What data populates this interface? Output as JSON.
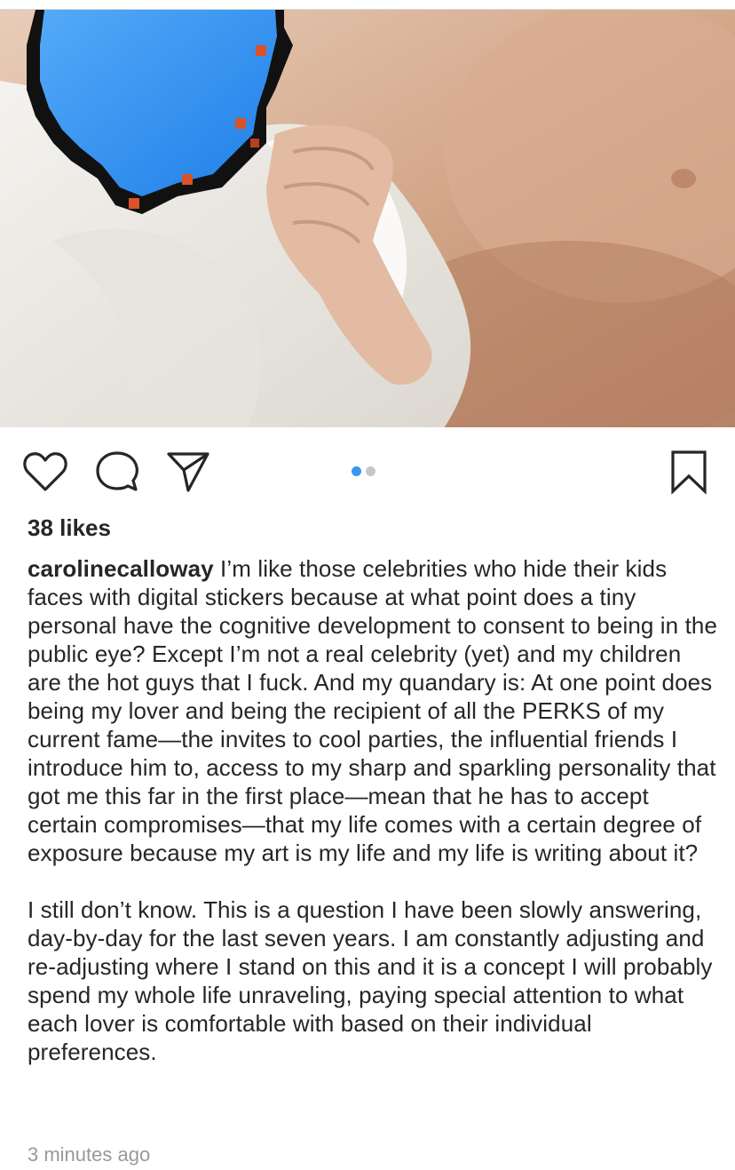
{
  "post": {
    "likes_text": "38 likes",
    "username": "carolinecalloway",
    "caption_paragraphs": [
      "I’m like those celebrities who hide their kids faces with digital stickers because at what point does a tiny personal have the cognitive development to consent to being in the public eye? Except I’m not a real celebrity (yet) and my children are the hot guys that I fuck. And my quandary is: At one point does being my lover and being the recipient of all the PERKS of my current fame—the invites to cool parties, the influential friends I introduce him to, access to my sharp and sparkling personality that got me this far in the first place—mean that he has to accept certain compromises—that my life comes with a certain degree of exposure because my art is my life and my life is writing about it?",
      "I still don’t know. This is a question I have been slowly answering, day-by-day for the last seven years. I am constantly adjusting and re-adjusting where I stand on this and it is a concept I will probably spend my whole life unraveling, paying special attention to what each lover is comfortable with based on their individual preferences."
    ],
    "timestamp": "3 minutes ago"
  },
  "carousel": {
    "current_index": 1,
    "total": 2
  },
  "actions": {
    "like_icon": "heart-outline-icon",
    "comment_icon": "speech-bubble-icon",
    "share_icon": "paper-plane-icon",
    "save_icon": "bookmark-outline-icon"
  },
  "colors": {
    "text": "#262626",
    "muted": "#999999",
    "accent": "#3897f0",
    "dot_inactive": "#c7c7c7",
    "sticker_blue": "#1f8cf5"
  }
}
